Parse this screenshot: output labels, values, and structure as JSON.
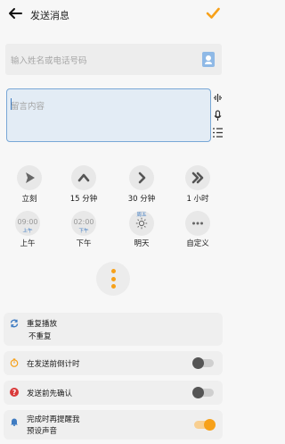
{
  "header": {
    "title": "发送消息"
  },
  "recipient": {
    "placeholder": "输入姓名或电话号码"
  },
  "message": {
    "placeholder": "留言内容"
  },
  "quick_times": [
    {
      "label": "立刻",
      "icon": "send-icon"
    },
    {
      "label": "15 分钟",
      "icon": "chevron-up-icon"
    },
    {
      "label": "30 分钟",
      "icon": "chevron-right-icon"
    },
    {
      "label": "1 小时",
      "icon": "double-chevron-right-icon"
    }
  ],
  "day_times": [
    {
      "label": "上午",
      "time": "09:00",
      "sub": "上午"
    },
    {
      "label": "下午",
      "time": "02:00",
      "sub": "下午"
    },
    {
      "label": "明天",
      "weekday": "周五",
      "icon": "sun-icon"
    },
    {
      "label": "自定义",
      "icon": "more-horizontal-icon"
    }
  ],
  "settings": {
    "repeat": {
      "title": "重复播放",
      "value": "不重复"
    },
    "countdown": {
      "label": "在发送前倒计时",
      "on": false
    },
    "confirm": {
      "label": "发送前先确认",
      "on": false
    },
    "remind": {
      "label_line1": "完成时再提醒我",
      "label_line2": "预设声音",
      "on": true
    }
  },
  "colors": {
    "accent": "#F7A11A",
    "blue": "#3F7CC2",
    "red": "#D93A3A"
  }
}
